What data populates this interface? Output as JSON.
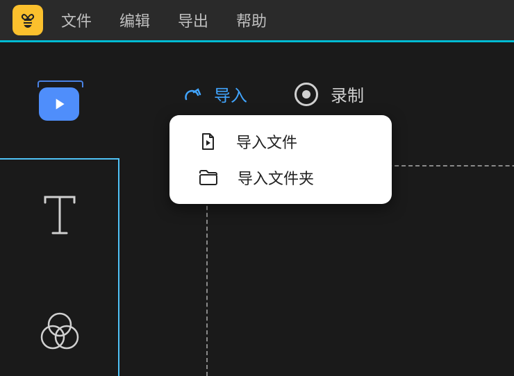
{
  "menu": {
    "file": "文件",
    "edit": "编辑",
    "export": "导出",
    "help": "帮助"
  },
  "actions": {
    "import": "导入",
    "record": "录制"
  },
  "popup": {
    "import_file": "导入文件",
    "import_folder": "导入文件夹"
  }
}
